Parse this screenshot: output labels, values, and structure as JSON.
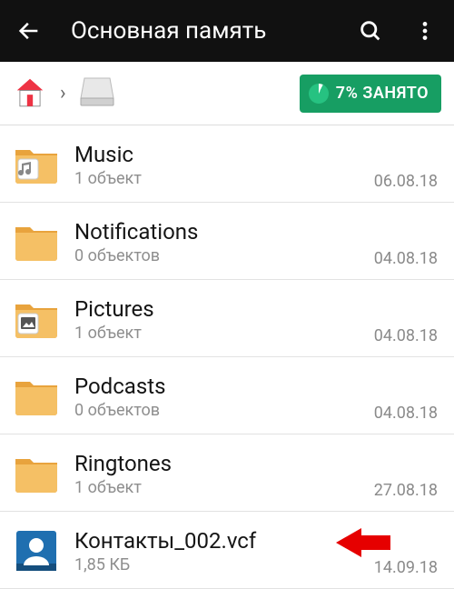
{
  "header": {
    "title": "Основная память"
  },
  "storage": {
    "percent_label": "7% ЗАНЯТО"
  },
  "items": [
    {
      "name": "Music",
      "sub": "1 объект",
      "date": "06.08.18",
      "type": "folder-music"
    },
    {
      "name": "Notifications",
      "sub": "0 объектов",
      "date": "04.08.18",
      "type": "folder"
    },
    {
      "name": "Pictures",
      "sub": "1 объект",
      "date": "04.08.18",
      "type": "folder-pictures"
    },
    {
      "name": "Podcasts",
      "sub": "0 объектов",
      "date": "04.08.18",
      "type": "folder"
    },
    {
      "name": "Ringtones",
      "sub": "1 объект",
      "date": "27.08.18",
      "type": "folder"
    },
    {
      "name": "Контакты_002.vcf",
      "sub": "1,85 КБ",
      "date": "14.09.18",
      "type": "vcf"
    }
  ]
}
